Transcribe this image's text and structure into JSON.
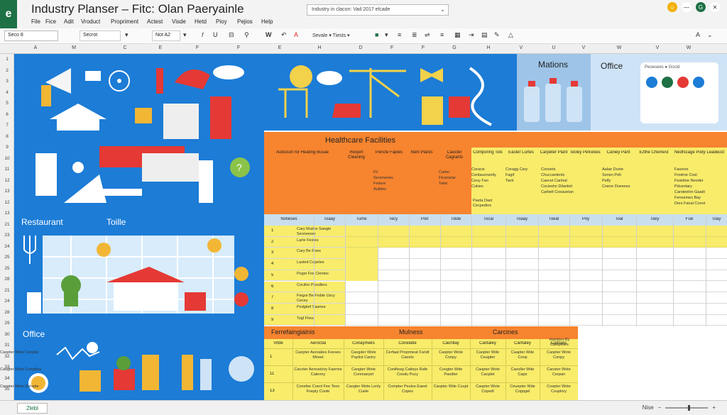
{
  "app": {
    "logo": "e",
    "title": "Industry Planser – Fitc: Olan Paeryainle",
    "search_value": "Industry in clacon: Vad 2017 elcade"
  },
  "menu": [
    "File",
    "Fice",
    "Adit",
    "Vroduct",
    "Propriment",
    "Actest",
    "Visde",
    "Hetd",
    "Pioy",
    "Pejios",
    "Help"
  ],
  "toolbar": {
    "name_box": "Seco 8",
    "font": "Secrot",
    "size": "Not A2",
    "bold": "W",
    "style_label": "Sevale ▾ Tiests ▾",
    "font_size_indicator": "A"
  },
  "columns": [
    "A",
    "M",
    "C",
    "E",
    "F",
    "F",
    "E",
    "H",
    "D",
    "F",
    "F",
    "G",
    "H",
    "V",
    "U",
    "V",
    "W",
    "V",
    "W"
  ],
  "rows": [
    "1",
    "2",
    "3",
    "4",
    "5",
    "6",
    "7",
    "8",
    "9",
    "10",
    "11",
    "12",
    "13",
    "12",
    "13",
    "21",
    "23",
    "24",
    "25",
    "25",
    "28",
    "21",
    "24",
    "28",
    "29",
    "30",
    "31",
    "32",
    "33",
    "34",
    "35"
  ],
  "panels": {
    "restaurant": "Restaurant",
    "toilet": "Toille",
    "office_left": "Office",
    "mations": "Mations",
    "office_right": "Office",
    "office_card": "Peoesees ● Gocid"
  },
  "healthcare": {
    "title": "Healthcare Facilities",
    "headers": [
      "Autisison for Heating Busae",
      "Resjert Cleaning",
      "Pencte Faples",
      "Nenl Plards",
      "Caocter Cagrants",
      "Comporing Tols",
      "Easter Lurtes",
      "Carpeter Plant",
      "Tecley Pefcekes",
      "Caniey Pant",
      "Ezthe Chemest",
      "Nedfscage Pioty Leadeust"
    ],
    "col1": [
      "Fli",
      "Sersmeries",
      "Federe",
      "Aulides"
    ],
    "col2": [
      "Carter",
      "Ftcarretar",
      "Tatet"
    ],
    "col3": [
      "Coracis",
      "Cenlauonzetly",
      "Ceuy Fan",
      "Cokies"
    ],
    "col4": [
      "Coragg Cary",
      "Fagif",
      "Tavlr"
    ],
    "col5": [
      "Conoets",
      "Chuccanlents",
      "Caecet Cantral",
      "Cocieshn Dilanleit",
      "Carbelt Cosauetan"
    ],
    "col6": [
      "Aalae Dcete",
      "Sonen Pelt",
      "Pelfy",
      "Coene Doeeses"
    ],
    "col7": [
      "Fassres",
      "Frodme Cost",
      "Fesidme Neoder",
      "Pdcentary",
      "Carsteelon Gaadi",
      "Fenoemes Bay",
      "Ders Fanal Conot"
    ],
    "comporing_note": "Paeta Dast Cecpedios"
  },
  "schedule": {
    "headers": [
      "Notieses",
      "Toaay",
      "Tume",
      "Tecy",
      "Poit",
      "Tolde",
      "Tocal",
      "Toaay",
      "Toeal",
      "Poy",
      "Toal",
      "Toey",
      "Fue",
      "Toay"
    ],
    "rows": [
      {
        "n": "1",
        "t": "Cary Mudes Sangle Seoneeser"
      },
      {
        "n": "2",
        "t": "Larte Festes"
      },
      {
        "n": "3",
        "t": "Cary Be Poes"
      },
      {
        "n": "4",
        "t": "Lasted Capetes"
      },
      {
        "n": "5",
        "t": "Pogst Fos Clentes"
      },
      {
        "n": "6",
        "t": "Cociliro Ploodlers"
      },
      {
        "n": "7",
        "t": "Fiegor Be Fisble Uscy Cecey"
      },
      {
        "n": "8",
        "t": "Pedgtief Saanee"
      },
      {
        "n": "9",
        "t": "Togl Fhes"
      }
    ]
  },
  "bottom": {
    "title": "Ferrefaingialnis",
    "sub1": "Mulness",
    "sub2": "Carcines",
    "headers": [
      "Vitde",
      "Aeroctal",
      "Conaymeks",
      "Conelatie",
      "Caunllay",
      "Cantaley",
      "Cantaley",
      "Catdaes",
      "Hambes-By Catepisies"
    ],
    "rows": [
      {
        "n": "1",
        "cells": [
          "Caopter Aeroaties Feeses Moeet",
          "Caogder Wote Paytist Caniry",
          "Cerfaat Proprmeat Fandt Caeets",
          "Caopter Wote Conpy",
          "Caopter Wde Ceugiter",
          "Caapter Wde Conp",
          "Caopter Wote Conpy",
          "Caopter Wote Ceoplet"
        ]
      },
      {
        "n": "11",
        "cells": [
          "Cacoter Aeroselory Faerme Catenny",
          "Caogter Wote Conmaeyet",
          "Conifieeg Catteys Rafe Coodu Pucy",
          "Coogter Wde Paodter",
          "Caopter Wote Caoplet",
          "Casoller Wde Capo",
          "Caoster Wote Cerpan",
          "Caogter Wote Conpltiey"
        ]
      },
      {
        "n": "13",
        "cells": [
          "Conefse Coenl Fee Teoo Fneply Coote",
          "Caogter Wote Lenly Cuele",
          "Compter Peulve Eaeet Copes",
          "Caopter Wde Coupt",
          "Caopter Wote Copedl",
          "Ceuepter Wde Coppgel",
          "Cvepter Wote Couplory",
          "Caopter Wote Dorspte"
        ]
      }
    ]
  },
  "status": {
    "sheet": "2lebl",
    "zoom_label": "Nise",
    "zoom_level": 0.55
  },
  "colors": {
    "excel_green": "#1e7145",
    "panel_blue": "#1c7cd6",
    "orange": "#f7842f",
    "yellow": "#f8ec6a"
  }
}
